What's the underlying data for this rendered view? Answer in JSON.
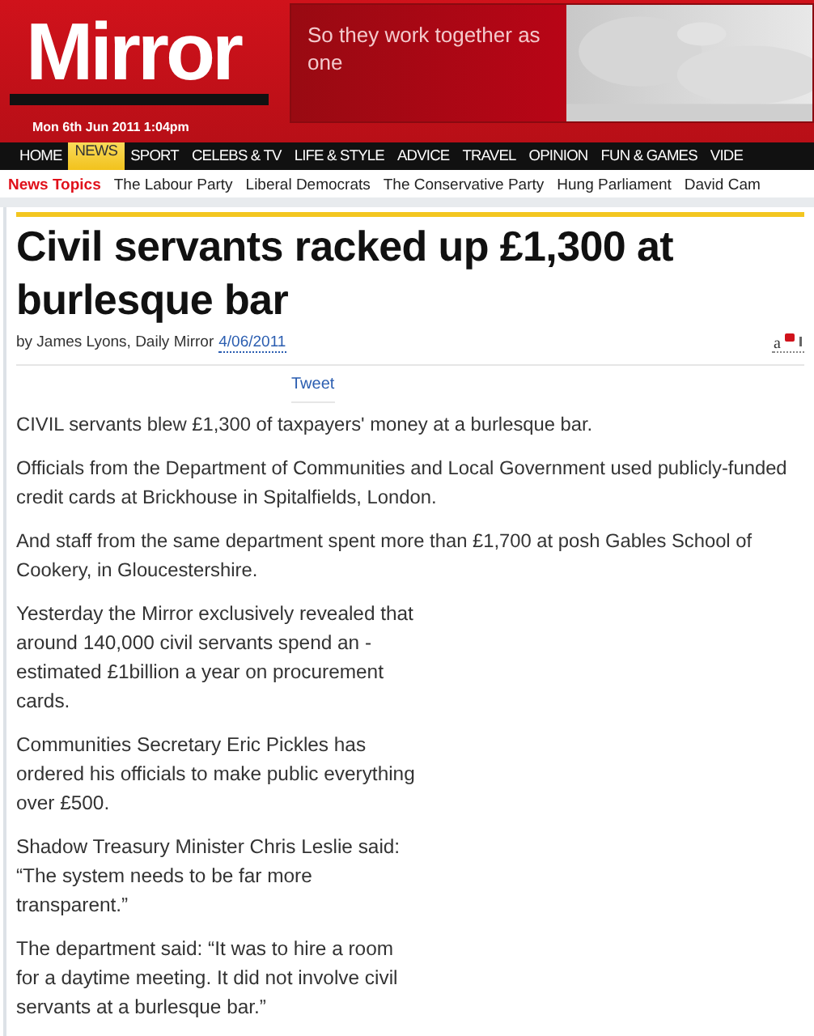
{
  "header": {
    "logo": "Mirror",
    "date": "Mon 6th Jun 2011 1:04pm",
    "ad": {
      "text": "So they work together as one",
      "kind": "picture"
    }
  },
  "nav": [
    {
      "label": "HOME",
      "selected": false
    },
    {
      "label": "NEWS",
      "selected": true
    },
    {
      "label": "SPORT",
      "selected": false
    },
    {
      "label": "CELEBS & TV",
      "selected": false
    },
    {
      "label": "LIFE & STYLE",
      "selected": false
    },
    {
      "label": "ADVICE",
      "selected": false
    },
    {
      "label": "TRAVEL",
      "selected": false
    },
    {
      "label": "OPINION",
      "selected": false
    },
    {
      "label": "FUN & GAMES",
      "selected": false
    },
    {
      "label": "VIDE",
      "selected": false
    }
  ],
  "topics": {
    "label": "News Topics",
    "items": [
      "The Labour Party",
      "Liberal Democrats",
      "The Conservative Party",
      "Hung Parliament",
      "David Cam"
    ]
  },
  "article": {
    "headline": "Civil servants racked up £1,300 at burlesque bar",
    "byline": "by James Lyons, Daily Mirror",
    "date": "4/06/2011",
    "tweet": "Tweet",
    "text_size": "a",
    "paragraphs": [
      "CIVIL servants blew £1,300 of taxpayers' money at a burlesque bar.",
      "Officials from the Department of Communities and Local Government used publicly-funded credit cards at Brickhouse in Spitalfields, London.",
      "And staff from the same department spent more than £1,700 at posh Gables School of Cookery, in Gloucestershire."
    ],
    "narrow_paragraphs": [
      "Yesterday the Mirror exclusively revealed that around 140,000 civil servants spend an - estimated £1billion a year on procurement cards.",
      "Communities Secretary Eric Pickles has ordered his officials to make public everything over £500.",
      "Shadow Treasury Minister Chris Leslie said: “The system needs to be far more transparent.”",
      "The department said: “It was to hire a room for a daytime meeting. It did not involve civil servants at a burlesque bar.”"
    ]
  }
}
